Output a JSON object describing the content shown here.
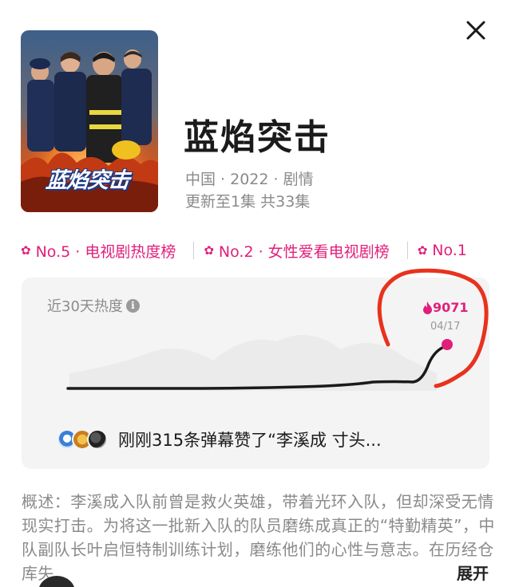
{
  "close": {
    "icon": "close-icon"
  },
  "poster": {
    "title": "蓝焰突击"
  },
  "show": {
    "title": "蓝焰突击",
    "meta": "中国 · 2022 · 剧情",
    "update": "更新至1集 共33集"
  },
  "rankings": [
    {
      "label": "No.5 · 电视剧热度榜"
    },
    {
      "label": "No.2 · 女性爱看电视剧榜"
    },
    {
      "label": "No.1"
    }
  ],
  "heat": {
    "label": "近30天热度",
    "value": "9071",
    "date": "04/17"
  },
  "danmaku": {
    "text": "刚刚315条弹幕赞了“李溪成 寸头..."
  },
  "description": {
    "text": "概述：李溪成入队前曾是救火英雄，带着光环入队，但却深受无情现实打击。为将这一批新入队的队员磨练成真正的“特勤精英”，中队副队长叶启恒特制训练计划，磨练他们的心性与意志。在历经仓库失",
    "expand_label": "展开"
  },
  "colors": {
    "accent": "#e0207a",
    "annotation": "#e8321e",
    "card_bg": "#f4f4f4"
  }
}
